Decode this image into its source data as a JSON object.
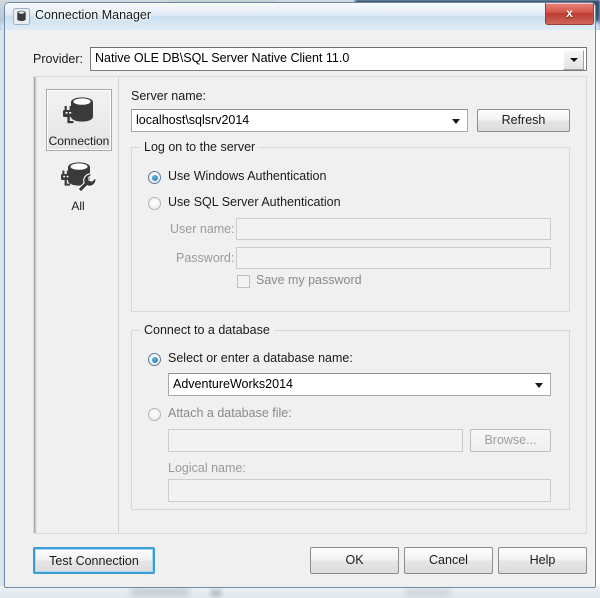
{
  "window": {
    "title": "Connection Manager",
    "icon": "database-icon",
    "close_label": "x",
    "accent_close": "#bb3b31",
    "accent_focus": "#3c9cd6"
  },
  "provider": {
    "label": "Provider:",
    "value": "Native OLE DB\\SQL Server Native Client 11.0",
    "dropdown_icon": "chevron-down-icon"
  },
  "sidebar": {
    "items": [
      {
        "label": "Connection",
        "icon": "database-plug-icon",
        "selected": true
      },
      {
        "label": "All",
        "icon": "database-wrench-icon",
        "selected": false
      }
    ]
  },
  "server": {
    "label": "Server name:",
    "value": "localhost\\sqlsrv2014",
    "refresh_label": "Refresh",
    "dropdown_icon": "chevron-down-icon"
  },
  "logon": {
    "group_title": "Log on to the server",
    "windows_auth": {
      "label": "Use Windows Authentication",
      "selected": true
    },
    "sql_auth": {
      "label": "Use SQL Server Authentication",
      "selected": false
    },
    "username": {
      "label": "User name:",
      "value": "",
      "disabled": true
    },
    "password": {
      "label": "Password:",
      "value": "",
      "disabled": true
    },
    "save_password": {
      "label": "Save my password",
      "checked": false,
      "disabled": true
    }
  },
  "database": {
    "group_title": "Connect to a database",
    "select_name": {
      "label": "Select or enter a database name:",
      "selected": true,
      "value": "AdventureWorks2014",
      "dropdown_icon": "chevron-down-icon"
    },
    "attach_file": {
      "label": "Attach a database file:",
      "selected": false,
      "value": "",
      "browse_label": "Browse...",
      "disabled": true
    },
    "logical_name": {
      "label": "Logical name:",
      "value": "",
      "disabled": true
    }
  },
  "footer": {
    "test_connection_label": "Test Connection",
    "ok_label": "OK",
    "cancel_label": "Cancel",
    "help_label": "Help"
  }
}
